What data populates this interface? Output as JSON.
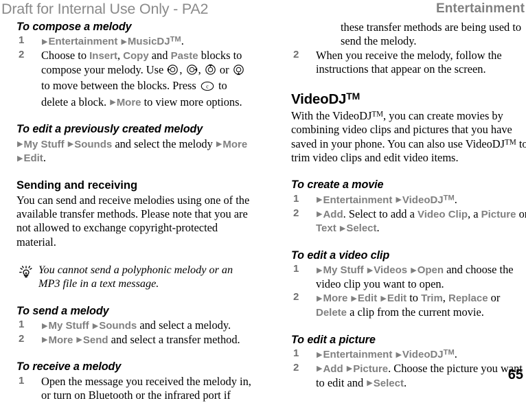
{
  "header": {
    "draft_watermark": "Draft for Internal Use Only - PA2",
    "running_head": "Entertainment"
  },
  "page_number": "65",
  "icons": {
    "nav_left": "nav-key-left-icon",
    "nav_right": "nav-key-right-icon",
    "nav_up": "nav-key-up-icon",
    "nav_down": "nav-key-down-icon",
    "clear_key": "clear-key-icon",
    "clear_key_label": "c",
    "tip": "lightbulb-tip-icon",
    "arrow": "select-arrow-icon"
  },
  "colors": {
    "ui_label_gray": "#808080",
    "watermark_gray": "#8a8a8a",
    "step_number_gray": "#6f6f6f",
    "body_black": "#000000"
  },
  "left_column": {
    "compose": {
      "heading": "To compose a melody",
      "step1": {
        "num": "1",
        "ui_entertainment": "Entertainment",
        "ui_musicdj": "MusicDJ",
        "tm": "TM",
        "trailing": "."
      },
      "step2": {
        "num": "2",
        "t1": "Choose to ",
        "ui_insert": "Insert",
        "t2": ", ",
        "ui_copy": "Copy",
        "t3": " and ",
        "ui_paste": "Paste",
        "t4": " blocks to compose your melody. Use ",
        "t5": ", ",
        "t6": ", ",
        "t7": " or ",
        "t8": " to move between the blocks. Press ",
        "t9": " to delete a block. ",
        "ui_more": "More",
        "t10": " to view more options."
      }
    },
    "edit_previous": {
      "heading": "To edit a previously created melody",
      "ui_my_stuff": "My Stuff",
      "ui_sounds": "Sounds",
      "t1": " and select the melody ",
      "ui_more": "More",
      "ui_edit": "Edit",
      "trailing": "."
    },
    "sending_receiving": {
      "heading": "Sending and receiving",
      "body": "You can send and receive melodies using one of the available transfer methods. Please note that you are not allowed to exchange copyright-protected material."
    },
    "note": {
      "text": "You cannot send a polyphonic melody or an MP3 file in a text message."
    },
    "send_melody": {
      "heading": "To send a melody",
      "step1": {
        "num": "1",
        "ui_my_stuff": "My Stuff",
        "ui_sounds": "Sounds",
        "t1": " and select a melody."
      },
      "step2": {
        "num": "2",
        "ui_more": "More",
        "ui_send": "Send",
        "t1": " and select a transfer method."
      }
    },
    "receive_melody": {
      "heading": "To receive a melody",
      "step1": {
        "num": "1",
        "text": "Open the message you received the melody in, or turn on Bluetooth or the infrared port if"
      }
    }
  },
  "right_column": {
    "receive_melody_cont": {
      "step1_cont": "these transfer methods are being used to send the melody.",
      "step2": {
        "num": "2",
        "text": "When you receive the melody, follow the instructions that appear on the screen."
      }
    },
    "videodj": {
      "heading": "VideoDJ",
      "heading_tm": "TM",
      "body_p1": "With the VideoDJ",
      "body_tm1": "TM",
      "body_p2": ", you can create movies by combining video clips and pictures that you have saved in your phone. You can also use VideoDJ",
      "body_tm2": "TM",
      "body_p3": " to trim video clips and edit video items."
    },
    "create_movie": {
      "heading": "To create a movie",
      "step1": {
        "num": "1",
        "ui_entertainment": "Entertainment",
        "ui_videodj": "VideoDJ",
        "tm": "TM",
        "trailing": "."
      },
      "step2": {
        "num": "2",
        "ui_add": "Add",
        "t1": ". Select to add a ",
        "ui_video_clip": "Video Clip",
        "t2": ", a ",
        "ui_picture": "Picture",
        "t3": " or ",
        "ui_text": "Text",
        "ui_select": "Select",
        "trailing": "."
      }
    },
    "edit_video_clip": {
      "heading": "To edit a video clip",
      "step1": {
        "num": "1",
        "ui_my_stuff": "My Stuff",
        "ui_videos": "Videos",
        "ui_open": "Open",
        "t1": " and choose the video clip you want to open."
      },
      "step2": {
        "num": "2",
        "ui_more": "More",
        "ui_edit1": "Edit",
        "ui_edit2": "Edit",
        "t1": " to ",
        "ui_trim": "Trim",
        "t2": ", ",
        "ui_replace": "Replace",
        "t3": " or ",
        "ui_delete": "Delete",
        "t4": " a clip from the current movie."
      }
    },
    "edit_picture": {
      "heading": "To edit a picture",
      "step1": {
        "num": "1",
        "ui_entertainment": "Entertainment",
        "ui_videodj": "VideoDJ",
        "tm": "TM",
        "trailing": "."
      },
      "step2": {
        "num": "2",
        "ui_add": "Add",
        "ui_picture": "Picture",
        "t1": ". Choose the picture you want to edit and ",
        "ui_select": "Select",
        "trailing": "."
      }
    }
  }
}
